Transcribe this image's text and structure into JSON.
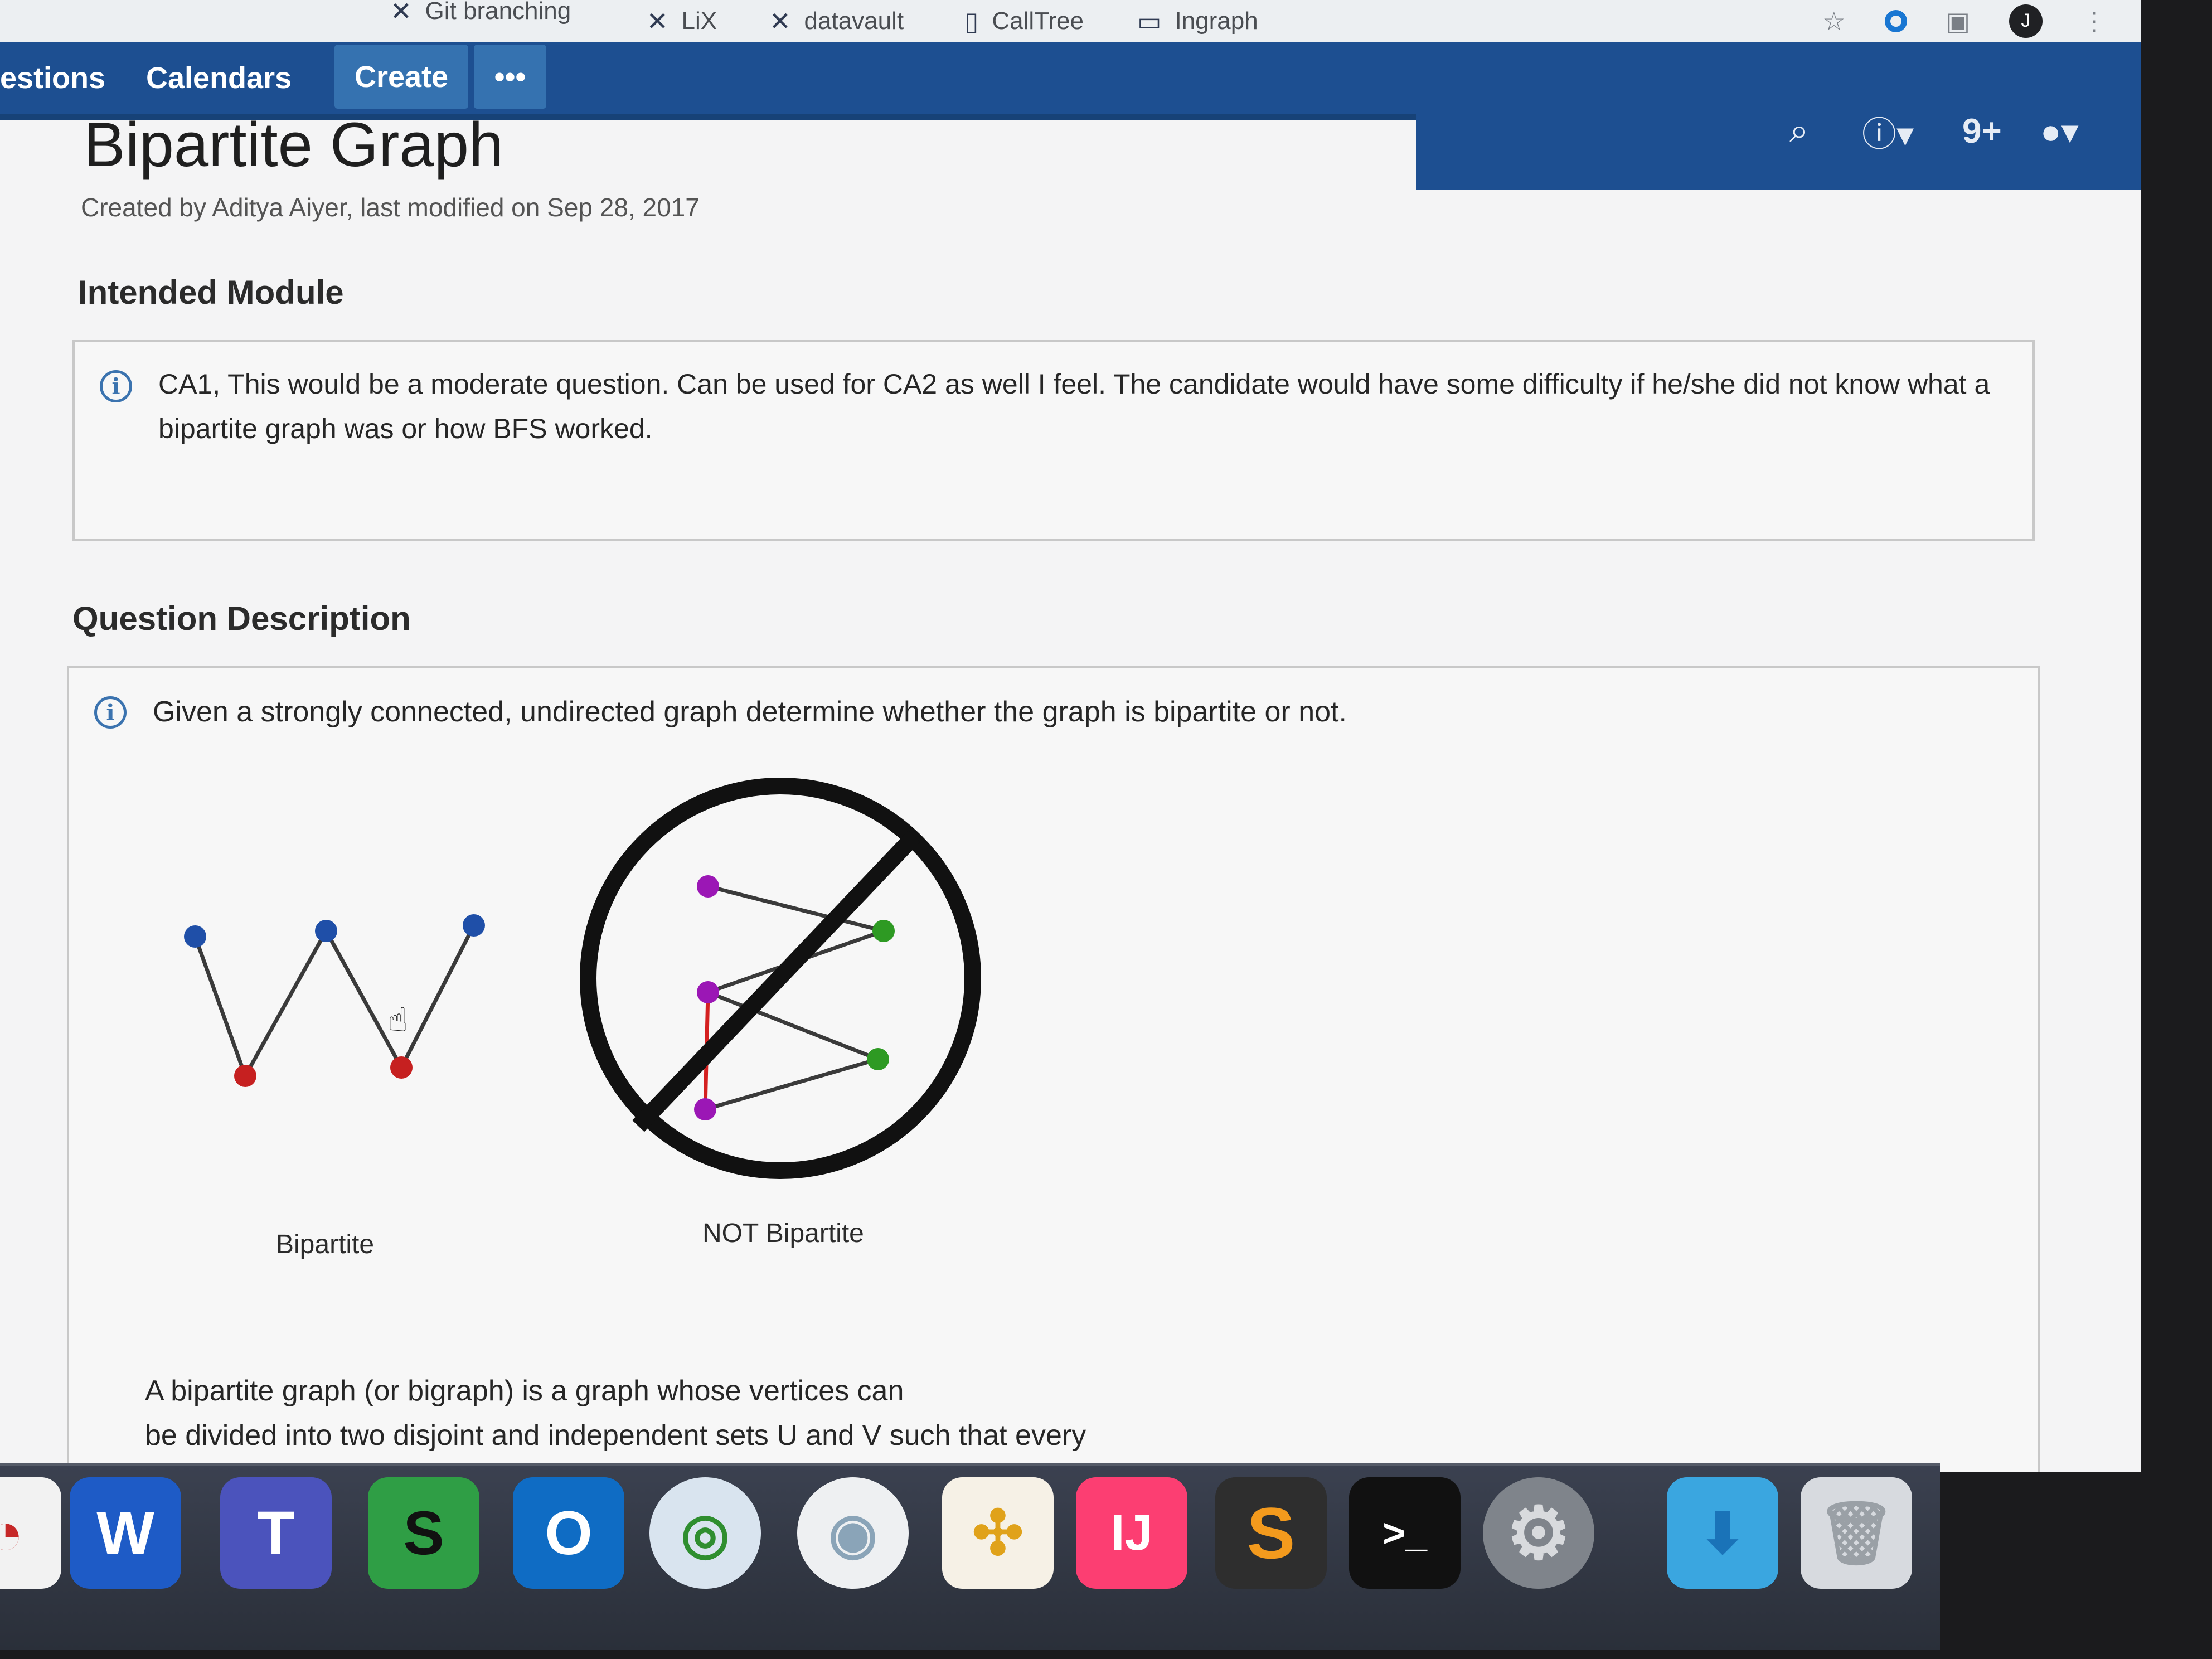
{
  "bookmarks": {
    "items": [
      {
        "label": "Git branching",
        "icon": "tool-icon"
      },
      {
        "label": "LiX",
        "icon": "tool-icon"
      },
      {
        "label": "datavault",
        "icon": "tool-icon"
      },
      {
        "label": "CallTree",
        "icon": "document-icon"
      },
      {
        "label": "Ingraph",
        "icon": "folder-icon"
      }
    ],
    "avatar_letter": "J"
  },
  "topnav": {
    "questions_label": "estions",
    "calendars_label": "Calendars",
    "create_label": "Create",
    "more_label": "•••",
    "notifications_badge": "9+"
  },
  "page": {
    "title": "Bipartite Graph",
    "byline": "Created by Aditya Aiyer, last modified on Sep 28, 2017",
    "intended_module": {
      "heading": "Intended Module",
      "text_line1": "CA1, This would be a moderate question. Can be used for CA2 as well I feel. The candidate would have some difficulty if he/she did not know what a",
      "text_line2": "bipartite graph was or how BFS worked."
    },
    "question_description": {
      "heading": "Question Description",
      "text": "Given a strongly connected, undirected graph determine whether the graph is bipartite or not.",
      "caption_left": "Bipartite",
      "caption_right": "NOT Bipartite",
      "para_line1": "A bipartite graph (or bigraph) is a graph whose vertices can",
      "para_line2": "be divided into two disjoint and independent sets U and V such that every"
    }
  },
  "colors": {
    "header_blue": "#1d4f91",
    "button_blue": "#3572b0",
    "vertex_blue": "#1f4fa8",
    "vertex_red": "#c62020",
    "vertex_purple": "#9b17b5",
    "vertex_green": "#2e9a23"
  },
  "dock": {
    "apps": [
      "Microsoft Word",
      "Microsoft Teams",
      "Skype for Business",
      "Microsoft Outlook",
      "VPN Client",
      "Wi-Fi Explorer",
      "Slack",
      "IntelliJ IDEA",
      "Sublime Text",
      "Terminal",
      "System Preferences",
      "Downloads",
      "Trash"
    ]
  }
}
